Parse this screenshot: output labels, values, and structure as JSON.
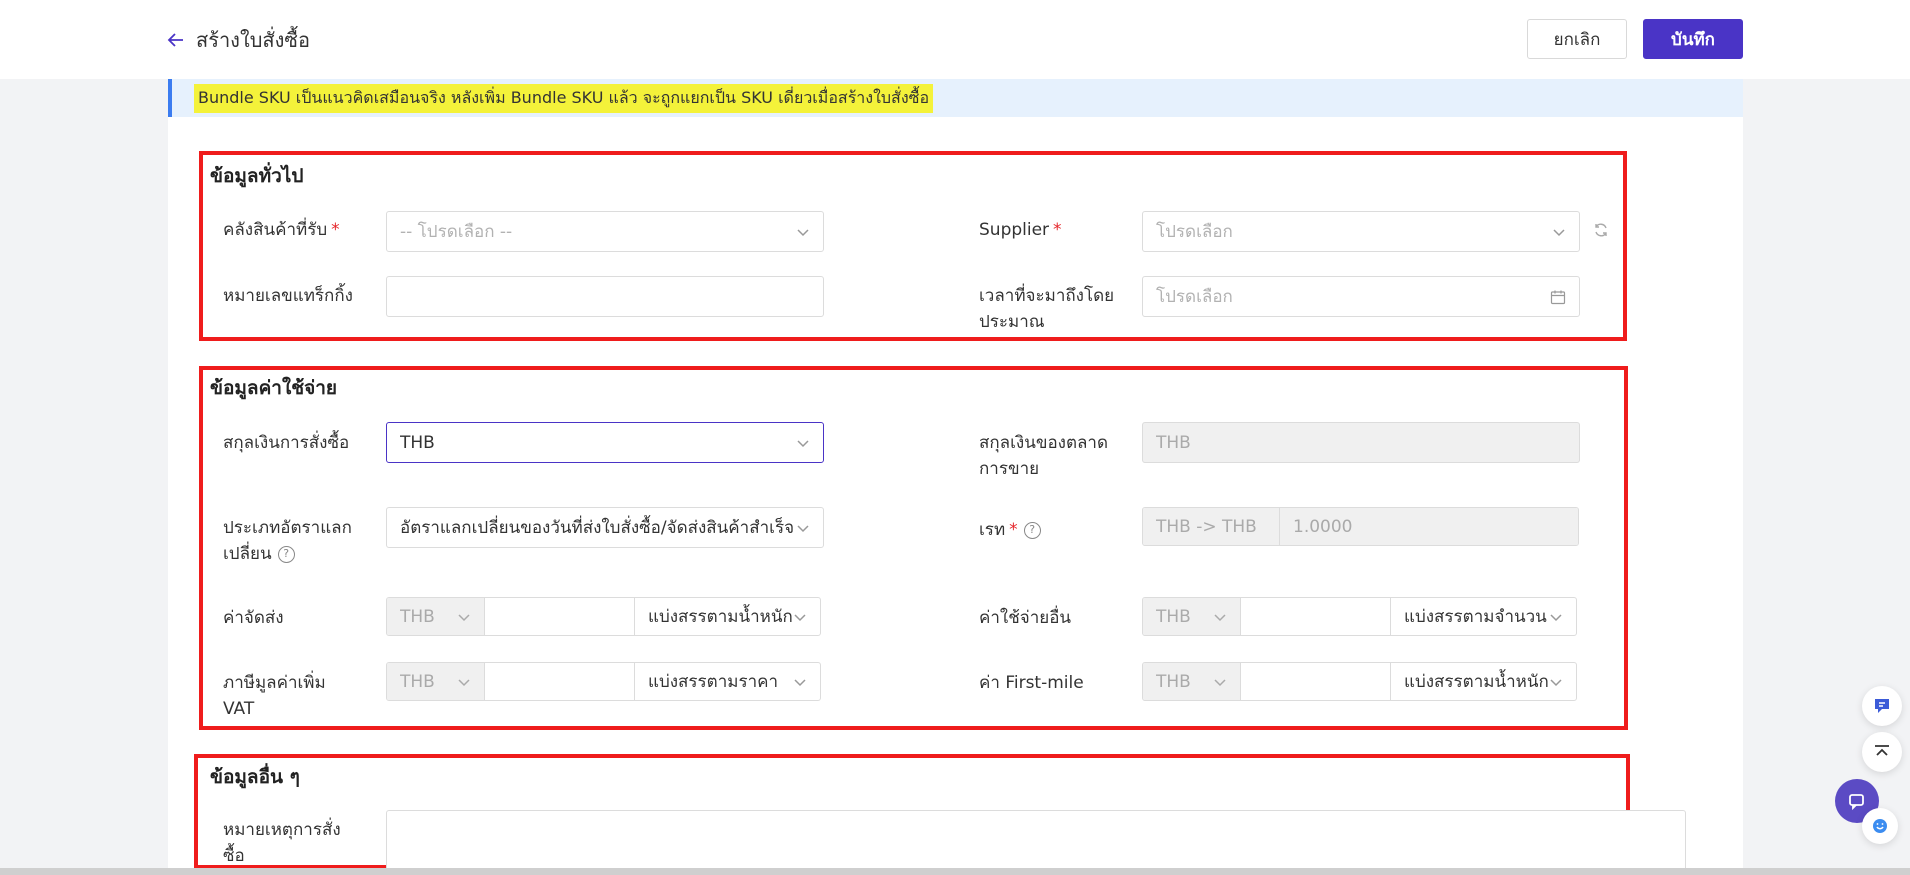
{
  "header": {
    "title": "สร้างใบสั่งซื้อ",
    "cancel_label": "ยกเลิก",
    "save_label": "บันทึก"
  },
  "notice": {
    "text": "Bundle SKU เป็นแนวคิดเสมือนจริง หลังเพิ่ม Bundle SKU แล้ว จะถูกแยกเป็น SKU เดี่ยวเมื่อสร้างใบสั่งซื้อ"
  },
  "general": {
    "title": "ข้อมูลทั่วไป",
    "warehouse_label": "คลังสินค้าที่รับ",
    "warehouse_placeholder": "-- โปรดเลือก --",
    "supplier_label": "Supplier",
    "supplier_placeholder": "โปรดเลือก",
    "tracking_label": "หมายเลขแทร็กกิ้ง",
    "tracking_value": "",
    "eta_label_1": "เวลาที่จะมาถึงโดย",
    "eta_label_2": "ประมาณ",
    "eta_placeholder": "โปรดเลือก"
  },
  "cost": {
    "title": "ข้อมูลค่าใช้จ่าย",
    "order_currency_label": "สกุลเงินการสั่งซื้อ",
    "order_currency_value": "THB",
    "market_currency_label_1": "สกุลเงินของตลาด",
    "market_currency_label_2": "การขาย",
    "market_currency_value": "THB",
    "rate_type_label_1": "ประเภทอัตราแลก",
    "rate_type_label_2": "เปลี่ยน",
    "rate_type_value": "อัตราแลกเปลี่ยนของวันที่ส่งใบสั่งซื้อ/จัดส่งสินค้าสำเร็จ",
    "rate_label": "เรท",
    "rate_pair": "THB -> THB",
    "rate_value": "1.0000",
    "shipping_label": "ค่าจัดส่ง",
    "shipping_currency": "THB",
    "shipping_amount": "",
    "shipping_split": "แบ่งสรรตามน้ำหนัก",
    "other_label": "ค่าใช้จ่ายอื่น",
    "other_currency": "THB",
    "other_amount": "",
    "other_split": "แบ่งสรรตามจำนวน",
    "vat_label_1": "ภาษีมูลค่าเพิ่ม",
    "vat_label_2": "VAT",
    "vat_currency": "THB",
    "vat_amount": "",
    "vat_split": "แบ่งสรรตามราคา",
    "firstmile_label": "ค่า First-mile",
    "firstmile_currency": "THB",
    "firstmile_amount": "",
    "firstmile_split": "แบ่งสรรตามน้ำหนัก"
  },
  "other": {
    "title": "ข้อมูลอื่น ๆ",
    "note_label_1": "หมายเหตุการสั่ง",
    "note_label_2": "ซื้อ",
    "note_value": ""
  },
  "colors": {
    "primary": "#4a34c6",
    "highlight_box": "#ef1c1c",
    "notice_bg": "#e6f1fd",
    "required": "#e5262b"
  },
  "icons": [
    "arrow-left-icon",
    "chevron-down-icon",
    "refresh-icon",
    "calendar-icon",
    "help-icon",
    "feedback-icon",
    "back-to-top-icon",
    "chat-icon"
  ]
}
